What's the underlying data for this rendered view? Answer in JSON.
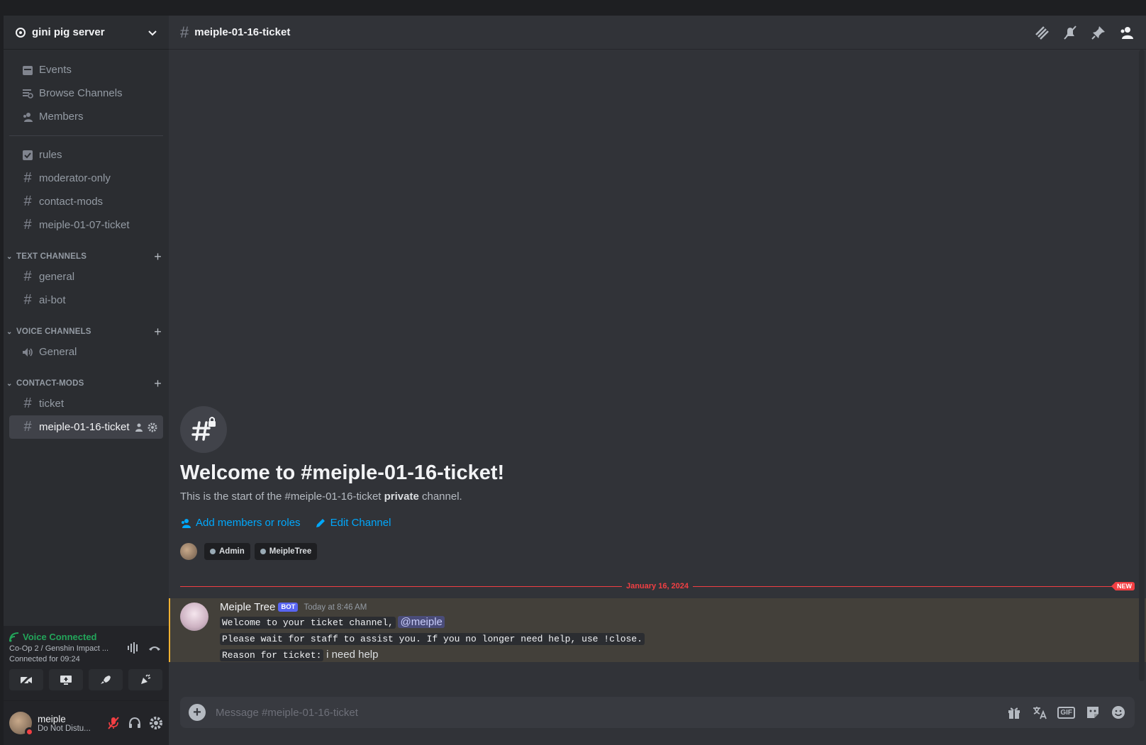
{
  "server": {
    "name": "gini pig server"
  },
  "nav": [
    {
      "label": "Events",
      "icon": "calendar-icon"
    },
    {
      "label": "Browse Channels",
      "icon": "browse-channels-icon"
    },
    {
      "label": "Members",
      "icon": "members-icon"
    }
  ],
  "top_channels": [
    {
      "label": "rules",
      "icon": "rules-icon"
    },
    {
      "label": "moderator-only",
      "icon": "locked-hash-icon"
    },
    {
      "label": "contact-mods",
      "icon": "hash-icon"
    },
    {
      "label": "meiple-01-07-ticket",
      "icon": "locked-hash-icon"
    }
  ],
  "categories": {
    "text": {
      "label": "TEXT CHANNELS",
      "channels": [
        "general",
        "ai-bot"
      ]
    },
    "voice": {
      "label": "VOICE CHANNELS",
      "channels": [
        "General"
      ]
    },
    "contact": {
      "label": "CONTACT-MODS",
      "channels": [
        "ticket",
        "meiple-01-16-ticket"
      ]
    }
  },
  "voice_status": {
    "title": "Voice Connected",
    "channel": "Co-Op 2 / Genshin Impact ...",
    "connected": "Connected for 09:24"
  },
  "user": {
    "name": "meiple",
    "status": "Do Not Distu..."
  },
  "channel": {
    "name": "meiple-01-16-ticket"
  },
  "welcome": {
    "title": "Welcome to #meiple-01-16-ticket!",
    "sub_prefix": "This is the start of the #meiple-01-16-ticket ",
    "sub_bold": "private",
    "sub_suffix": " channel.",
    "add_members": "Add members or roles",
    "edit_channel": "Edit Channel",
    "roles": [
      "Admin",
      "MeipleTree"
    ]
  },
  "divider": {
    "date": "January 16, 2024",
    "new_label": "NEW"
  },
  "message": {
    "author": "Meiple Tree",
    "bot_tag": "BOT",
    "time": "Today at 8:46 AM",
    "line1_code": "Welcome to your ticket channel,",
    "line1_mention": "@meiple",
    "line2_code": "Please wait for staff to assist you. If you no longer need help, use !close.",
    "line3_code": "Reason for ticket:",
    "line3_text": "i need help"
  },
  "composer": {
    "placeholder": "Message #meiple-01-16-ticket"
  },
  "colors": {
    "accent": "#5865f2",
    "link": "#00a8fc",
    "voice_green": "#23a55a",
    "dnd_red": "#f23f43",
    "highlight": "#f0b132"
  }
}
